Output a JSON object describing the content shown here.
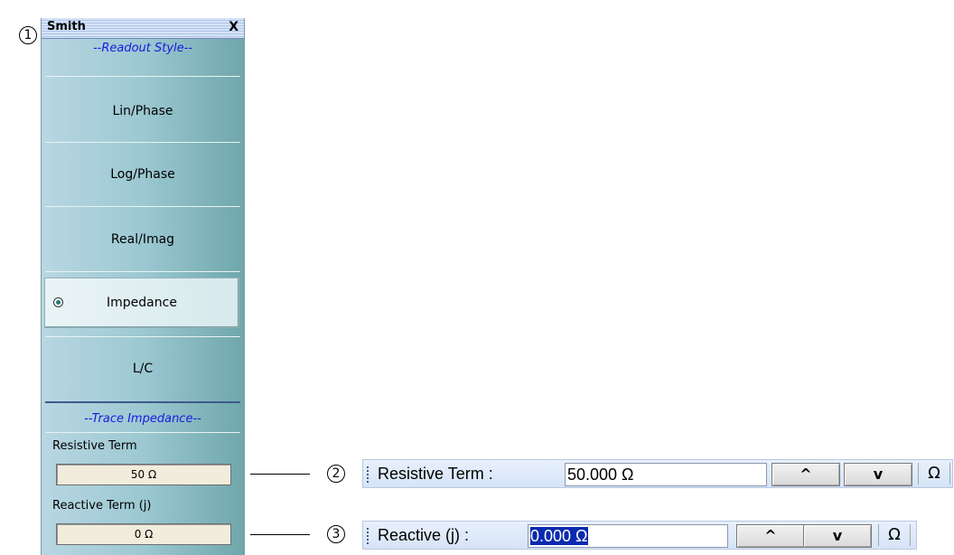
{
  "callouts": [
    "1",
    "2",
    "3"
  ],
  "panel": {
    "title": "Smith",
    "close_label": "X",
    "readout_section": "--Readout Style--",
    "items": [
      {
        "label": "Lin/Phase",
        "selected": false
      },
      {
        "label": "Log/Phase",
        "selected": false
      },
      {
        "label": "Real/Imag",
        "selected": false
      },
      {
        "label": "Impedance",
        "selected": true
      },
      {
        "label": "L/C",
        "selected": false
      }
    ],
    "trace_section": "--Trace Impedance--",
    "resistive_label": "Resistive Term",
    "resistive_value": "50 Ω",
    "reactive_label": "Reactive Term (j)",
    "reactive_value": "0 Ω"
  },
  "toolbar_resistive": {
    "label": "Resistive Term :",
    "value": "50.000  Ω",
    "up_icon": "^",
    "down_icon": "v",
    "unit": "Ω"
  },
  "toolbar_reactive": {
    "label": "Reactive (j) :",
    "value": "0.000  Ω",
    "up_icon": "^",
    "down_icon": "v",
    "unit": "Ω"
  }
}
